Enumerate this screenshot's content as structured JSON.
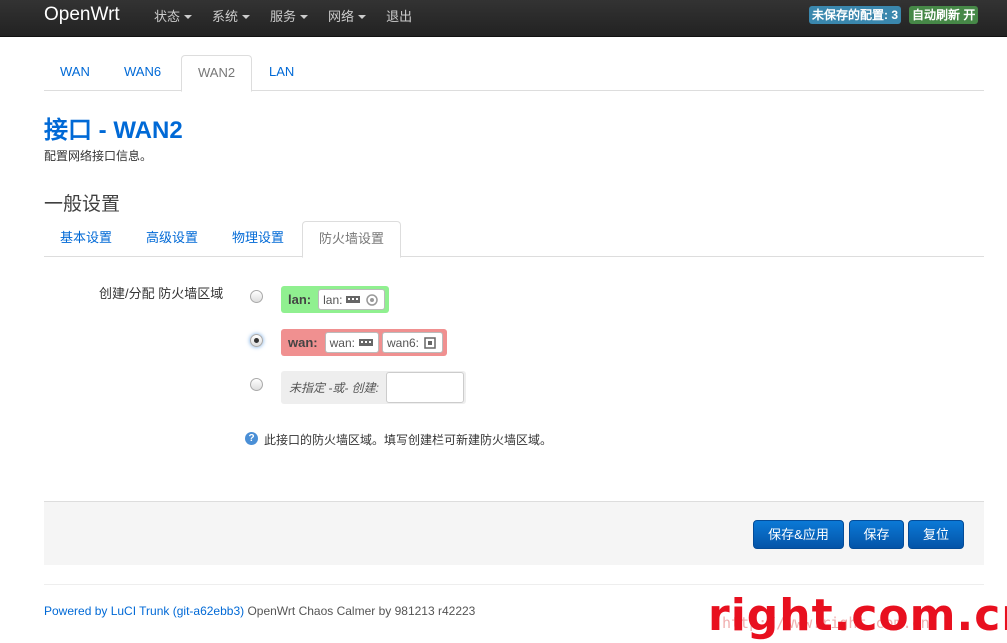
{
  "navbar": {
    "brand": "OpenWrt",
    "menu": [
      {
        "label": "状态",
        "dropdown": true
      },
      {
        "label": "系统",
        "dropdown": true
      },
      {
        "label": "服务",
        "dropdown": true
      },
      {
        "label": "网络",
        "dropdown": true
      },
      {
        "label": "退出",
        "dropdown": false
      }
    ],
    "unsaved_badge": "未保存的配置: 3",
    "refresh_badge": "自动刷新 开"
  },
  "interface_tabs": [
    "WAN",
    "WAN6",
    "WAN2",
    "LAN"
  ],
  "active_interface_tab": "WAN2",
  "page": {
    "title": "接口 - WAN2",
    "description": "配置网络接口信息。",
    "section_title": "一般设置"
  },
  "settings_tabs": [
    "基本设置",
    "高级设置",
    "物理设置",
    "防火墙设置"
  ],
  "active_settings_tab": "防火墙设置",
  "firewall": {
    "field_label": "创建/分配 防火墙区域",
    "zones": [
      {
        "name": "lan:",
        "color": "#90f090",
        "checked": false,
        "interfaces": [
          "lan:"
        ]
      },
      {
        "name": "wan:",
        "color": "#f09090",
        "checked": true,
        "interfaces": [
          "wan:",
          "wan6:"
        ]
      }
    ],
    "unspecified_label": "未指定 -或- 创建:",
    "unspecified_value": "",
    "help_text": "此接口的防火墙区域。填写创建栏可新建防火墙区域。"
  },
  "actions": {
    "save_apply": "保存&应用",
    "save": "保存",
    "reset": "复位"
  },
  "footer": {
    "link_text": "Powered by LuCI Trunk (git-a62ebb3)",
    "rest": " OpenWrt Chaos Calmer by 981213 r42223"
  },
  "watermark": {
    "main": "right.com.cn",
    "sub": "http://www.right.com.cn"
  }
}
